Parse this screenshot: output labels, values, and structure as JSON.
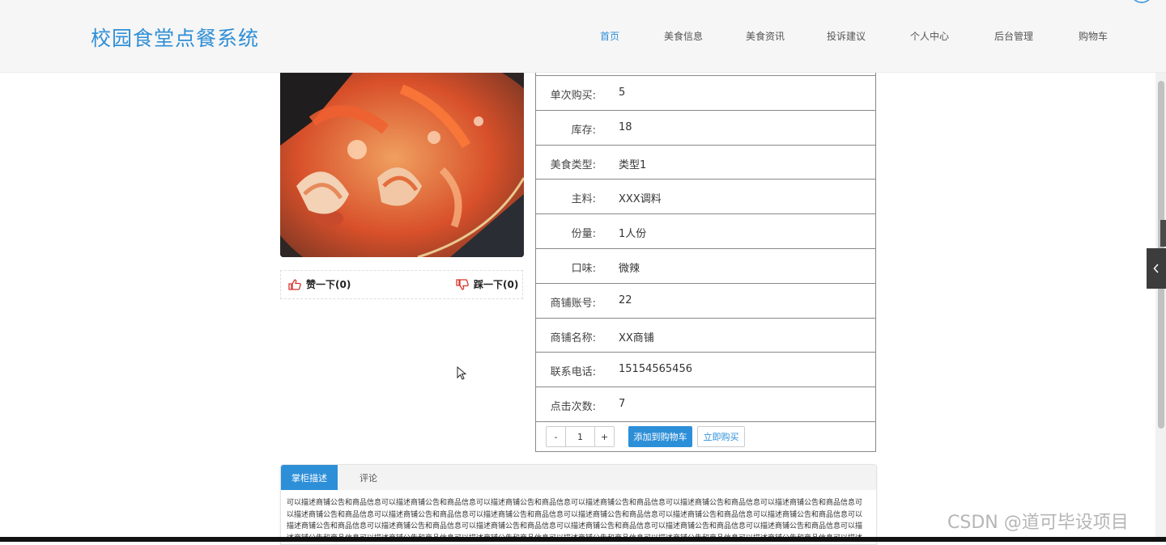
{
  "header": {
    "logo": "校园食堂点餐系统",
    "nav": [
      "首页",
      "美食信息",
      "美食资讯",
      "投诉建议",
      "个人中心",
      "后台管理",
      "购物车"
    ],
    "active_index": 0,
    "accent_color": "#2f8fd6"
  },
  "votes": {
    "like": "赞一下(0)",
    "dislike": "踩一下(0)"
  },
  "details": [
    {
      "label": "单次购买:",
      "value": "5"
    },
    {
      "label": "库存:",
      "value": "18"
    },
    {
      "label": "美食类型:",
      "value": "类型1"
    },
    {
      "label": "主料:",
      "value": "XXX调料"
    },
    {
      "label": "份量:",
      "value": "1人份"
    },
    {
      "label": "口味:",
      "value": "微辣"
    },
    {
      "label": "商铺账号:",
      "value": "22"
    },
    {
      "label": "商铺名称:",
      "value": "XX商铺"
    },
    {
      "label": "联系电话:",
      "value": "15154565456"
    },
    {
      "label": "点击次数:",
      "value": "7"
    }
  ],
  "actions": {
    "minus": "-",
    "quantity": "1",
    "plus": "+",
    "add_to_cart": "添加到购物车",
    "buy_now": "立即购买"
  },
  "tabs": {
    "active": "掌柜描述",
    "other": "评论",
    "description": "可以描述商铺公告和商品信息可以描述商铺公告和商品信息可以描述商铺公告和商品信息可以描述商铺公告和商品信息可以描述商铺公告和商品信息可以描述商铺公告和商品信息可以描述商铺公告和商品信息可以描述商铺公告和商品信息可以描述商铺公告和商品信息可以描述商铺公告和商品信息可以描述商铺公告和商品信息可以描述商铺公告和商品信息可以描述商铺公告和商品信息可以描述商铺公告和商品信息可以描述商铺公告和商品信息可以描述商铺公告和商品信息可以描述商铺公告和商品信息可以描述商铺公告和商品信息可以描述商铺公告和商品信息可以描述商铺公告和商品信息可以描述商铺公告和商品信息可以描述商铺公告和商品信息可以描述商铺公告和商品信息可以描述商铺公告和商品信息可以描述商铺公告和商品信息可以描述商铺公告和商品信息"
  },
  "watermark": "CSDN @道可毕设项目"
}
